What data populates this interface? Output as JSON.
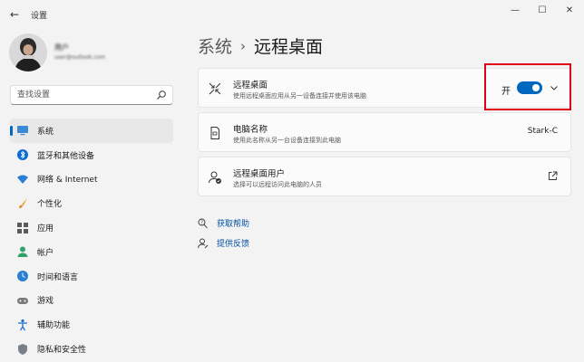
{
  "window": {
    "back_icon": "←",
    "title": "设置",
    "min_icon": "—",
    "max_icon": "☐",
    "close_icon": "✕"
  },
  "user": {
    "name": "用户",
    "email": "user@outlook.com"
  },
  "search": {
    "placeholder": "查找设置",
    "icon": "search-icon"
  },
  "nav": {
    "items": [
      {
        "label": "系统",
        "icon": "monitor-icon",
        "active": true
      },
      {
        "label": "蓝牙和其他设备",
        "icon": "bluetooth-icon"
      },
      {
        "label": "网络 & Internet",
        "icon": "wifi-icon"
      },
      {
        "label": "个性化",
        "icon": "brush-icon"
      },
      {
        "label": "应用",
        "icon": "apps-icon"
      },
      {
        "label": "帐户",
        "icon": "person-icon"
      },
      {
        "label": "时间和语言",
        "icon": "clock-globe-icon"
      },
      {
        "label": "游戏",
        "icon": "gamepad-icon"
      },
      {
        "label": "辅助功能",
        "icon": "accessibility-icon"
      },
      {
        "label": "隐私和安全性",
        "icon": "shield-icon"
      }
    ]
  },
  "breadcrumb": {
    "parent": "系统",
    "separator": "›",
    "current": "远程桌面"
  },
  "cards": {
    "remote_desktop": {
      "title": "远程桌面",
      "description": "使用远程桌面应用从另一设备连接并使用该电脑",
      "toggle_label": "开",
      "toggle_on": true,
      "icon": "remote-desktop-icon"
    },
    "pc_name": {
      "title": "电脑名称",
      "description": "使用此名称从另一台设备连接到此电脑",
      "value": "Stark-C",
      "icon": "pc-document-icon"
    },
    "remote_users": {
      "title": "远程桌面用户",
      "description": "选择可以远程访问此电脑的人员",
      "icon": "users-icon"
    }
  },
  "links": {
    "help": "获取帮助",
    "feedback": "提供反馈"
  },
  "colors": {
    "accent": "#0067c0",
    "highlight_box": "#e0001b",
    "background": "#f3f3f3",
    "card": "#fbfbfb"
  }
}
